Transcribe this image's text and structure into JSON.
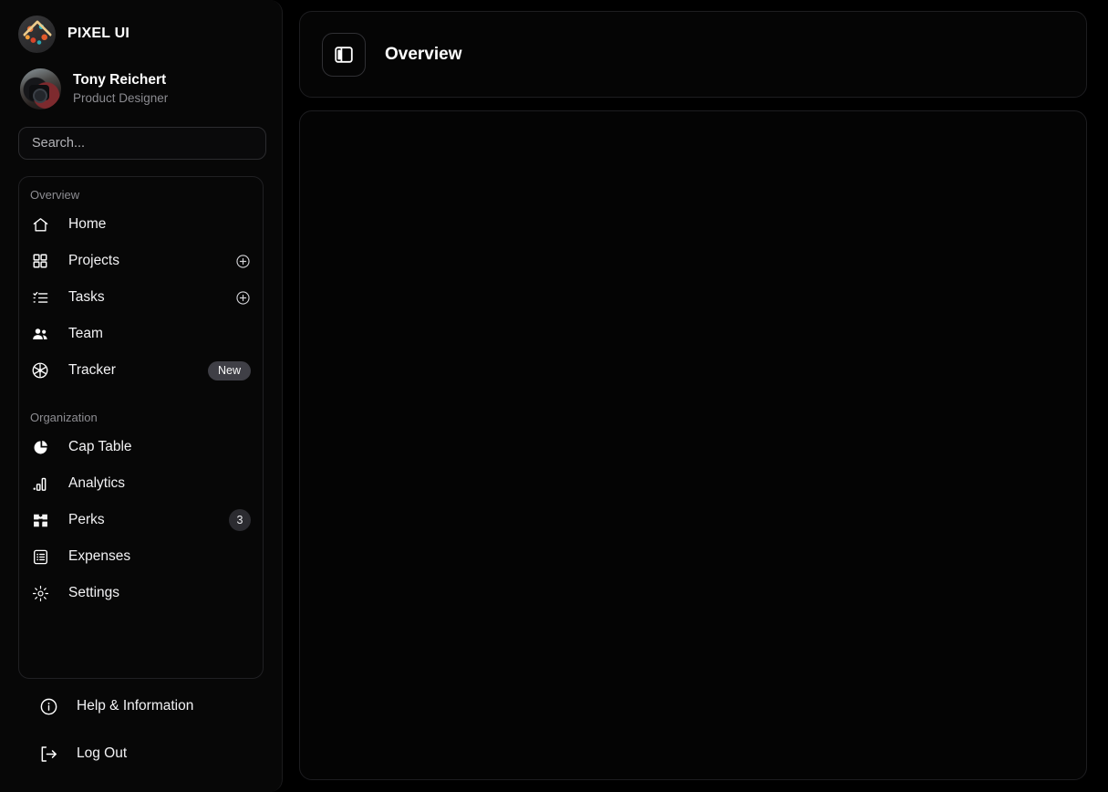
{
  "brand": {
    "name": "PIXEL UI",
    "logo_icon": "pixel-logo-icon"
  },
  "profile": {
    "name": "Tony Reichert",
    "role": "Product Designer",
    "avatar_icon": "user-avatar"
  },
  "search": {
    "placeholder": "Search...",
    "value": ""
  },
  "sidebar": {
    "sections": [
      {
        "label": "Overview",
        "items": [
          {
            "label": "Home",
            "icon": "home-icon",
            "badge": null,
            "action": null
          },
          {
            "label": "Projects",
            "icon": "grid-icon",
            "badge": null,
            "action": "plus-icon"
          },
          {
            "label": "Tasks",
            "icon": "checklist-icon",
            "badge": null,
            "action": "plus-icon"
          },
          {
            "label": "Team",
            "icon": "users-icon",
            "badge": null,
            "action": null
          },
          {
            "label": "Tracker",
            "icon": "tracker-icon",
            "badge": "New",
            "badge_type": "pill",
            "action": null
          }
        ]
      },
      {
        "label": "Organization",
        "items": [
          {
            "label": "Cap Table",
            "icon": "pie-chart-icon",
            "badge": null,
            "action": null
          },
          {
            "label": "Analytics",
            "icon": "bar-chart-icon",
            "badge": null,
            "action": null
          },
          {
            "label": "Perks",
            "icon": "gift-icon",
            "badge": "3",
            "badge_type": "count",
            "action": null
          },
          {
            "label": "Expenses",
            "icon": "list-icon",
            "badge": null,
            "action": null
          },
          {
            "label": "Settings",
            "icon": "gear-icon",
            "badge": null,
            "action": null
          }
        ]
      }
    ],
    "footer": [
      {
        "label": "Help & Information",
        "icon": "info-icon"
      },
      {
        "label": "Log Out",
        "icon": "logout-icon"
      }
    ]
  },
  "topbar": {
    "title": "Overview",
    "toggle_icon": "sidebar-toggle-icon"
  },
  "colors": {
    "background": "#000000",
    "panel": "#050505",
    "border": "#1d1d20",
    "text_primary": "#ffffff",
    "text_muted": "#8b8b90",
    "badge_new_bg": "#3f3f46",
    "badge_count_bg": "#2b2b30"
  }
}
